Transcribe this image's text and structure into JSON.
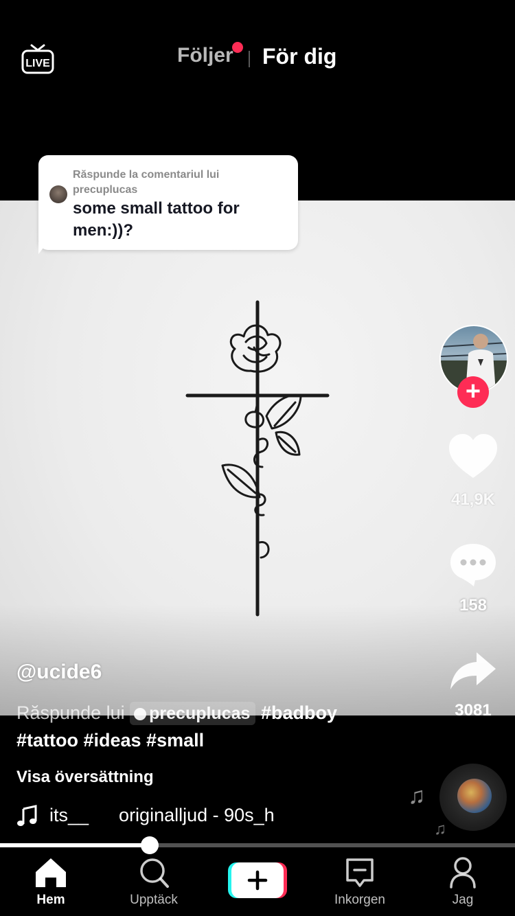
{
  "header": {
    "live_label": "LIVE",
    "tab_following": "Följer",
    "tab_for_you": "För dig"
  },
  "reply_bubble": {
    "heading": "Răspunde la comentariul lui precuplucas",
    "comment": "some small tattoo for men:))?"
  },
  "rail": {
    "like_count": "41,9K",
    "comment_count": "158",
    "share_count": "3081"
  },
  "caption": {
    "username": "@ucide6",
    "reply_prefix": "Răspunde lui",
    "mention": "precuplucas",
    "hashtags_line1": "#badboy",
    "hashtags_line2": "#tattoo #ideas #small",
    "translate_label": "Visa översättning"
  },
  "music": {
    "track_part1": "its__",
    "track_part2": "originalljud - 90s_h"
  },
  "progress": {
    "fraction": 0.29
  },
  "nav": {
    "home": "Hem",
    "discover": "Upptäck",
    "create": "",
    "inbox": "Inkorgen",
    "profile": "Jag"
  },
  "colors": {
    "accent": "#fe2c55",
    "create_left": "#25f4ee",
    "create_right": "#fe2c55"
  }
}
